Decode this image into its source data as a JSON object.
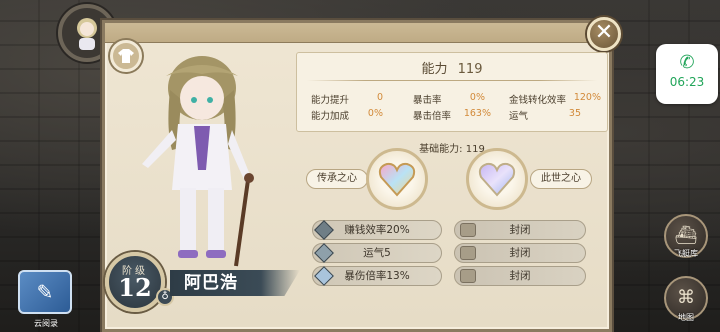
{
  "header": {
    "close_icon": "close-icon",
    "outfit_icon": "shirt-icon"
  },
  "character": {
    "rank_label": "阶级",
    "rank_value": "12",
    "name": "阿巴浩"
  },
  "ability": {
    "title": "能力",
    "value": "119",
    "stats": [
      {
        "label": "能力提升",
        "value": "0"
      },
      {
        "label": "暴击率",
        "value": "0%"
      },
      {
        "label": "金钱转化效率",
        "value": "120%"
      },
      {
        "label": "能力加成",
        "value": "0%"
      },
      {
        "label": "暴击倍率",
        "value": "163%"
      },
      {
        "label": "运气",
        "value": "35"
      }
    ]
  },
  "base": {
    "label": "基础能力: 119",
    "left_heart": "传承之心",
    "right_heart": "此世之心"
  },
  "skills": {
    "left": [
      "赚钱效率20%",
      "运气5",
      "暴伤倍率13%"
    ],
    "right": [
      "封闭",
      "封闭",
      "封闭"
    ]
  },
  "side": {
    "call_time": "06:23",
    "airship_label": "飞艇库",
    "map_label": "地图",
    "cloud_label": "云阅录"
  }
}
